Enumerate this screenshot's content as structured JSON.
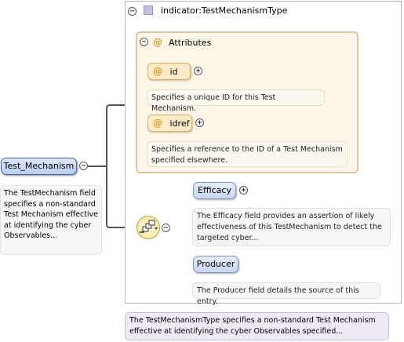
{
  "root": {
    "name": "Test_Mechanism",
    "description": "The TestMechanism field specifies a non-standard Test Mechanism effective at identifying the cyber Observables..."
  },
  "type": {
    "title": "indicator:TestMechanismType",
    "description": "The TestMechanismType specifies a non-standard Test Mechanism effective at identifying the cyber Observables specified..."
  },
  "attributes": {
    "title": "Attributes",
    "symbol": "@",
    "items": [
      {
        "name": "id",
        "description": "Specifies a unique ID for this Test Mechanism."
      },
      {
        "name": "idref",
        "description": "Specifies a reference to the ID of a Test Mechanism specified elsewhere."
      }
    ]
  },
  "sequence": {
    "elements": [
      {
        "name": "Efficacy",
        "description": "The Efficacy field provides an assertion of likely effectiveness of this TestMechanism to detect the targeted cyber..."
      },
      {
        "name": "Producer",
        "description": "The Producer field details the source of this entry."
      }
    ]
  },
  "toggles": {
    "collapse": "−",
    "expand": "+"
  },
  "colors": {
    "element_fill": "#c9d7f0",
    "attribute_fill": "#fdeac8",
    "type_square": "#c6bde3",
    "sequence_fill": "#f4e38a"
  }
}
